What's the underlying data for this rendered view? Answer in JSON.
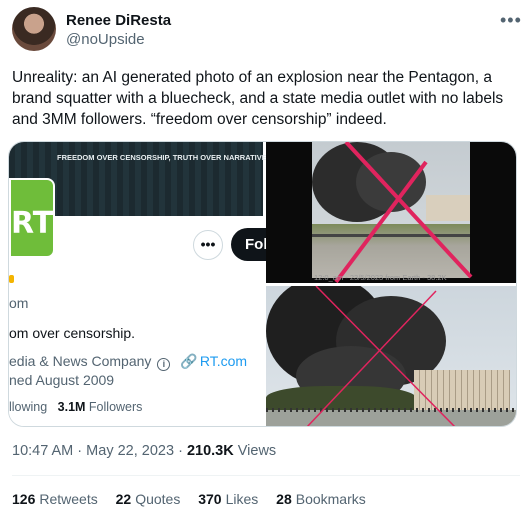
{
  "author": {
    "display_name": "Renee DiResta",
    "handle": "@noUpside"
  },
  "tweet": {
    "text": "Unreality: an AI generated photo of an explosion near the Pentagon, a brand squatter with a bluecheck, and a state media outlet with no labels and 3MM followers. “freedom over censorship” indeed."
  },
  "rt_screenshot": {
    "banner_text": "FREEDOM OVER CENSORSHIP, TRUTH OVER NARRATIVE.",
    "logo_text": "RT",
    "more_label": "•••",
    "follow_label": "Fol",
    "handle_fragment": "om",
    "bio_fragment": "om over censorship.",
    "category_fragment": "edia & News Company",
    "info_icon": "i",
    "link_icon": "🔗",
    "link_text": "RT.com",
    "joined_fragment": "ned August 2009",
    "following_fragment": "llowing",
    "followers_count": "3.1M",
    "followers_label": "Followers"
  },
  "photo1": {
    "caption": "12:0_am - 23/5/2023 from Earth - 38.2K"
  },
  "meta": {
    "time": "10:47 AM",
    "separator": "·",
    "date": "May 22, 2023",
    "views_count": "210.3K",
    "views_label": "Views"
  },
  "stats": {
    "retweets_count": "126",
    "retweets_label": "Retweets",
    "quotes_count": "22",
    "quotes_label": "Quotes",
    "likes_count": "370",
    "likes_label": "Likes",
    "bookmarks_count": "28",
    "bookmarks_label": "Bookmarks"
  },
  "icons": {
    "more": "more-horizontal-icon"
  },
  "colors": {
    "accent": "#1d9bf0",
    "rt_green": "#6fbd3a",
    "cross_red": "#e0245e"
  }
}
